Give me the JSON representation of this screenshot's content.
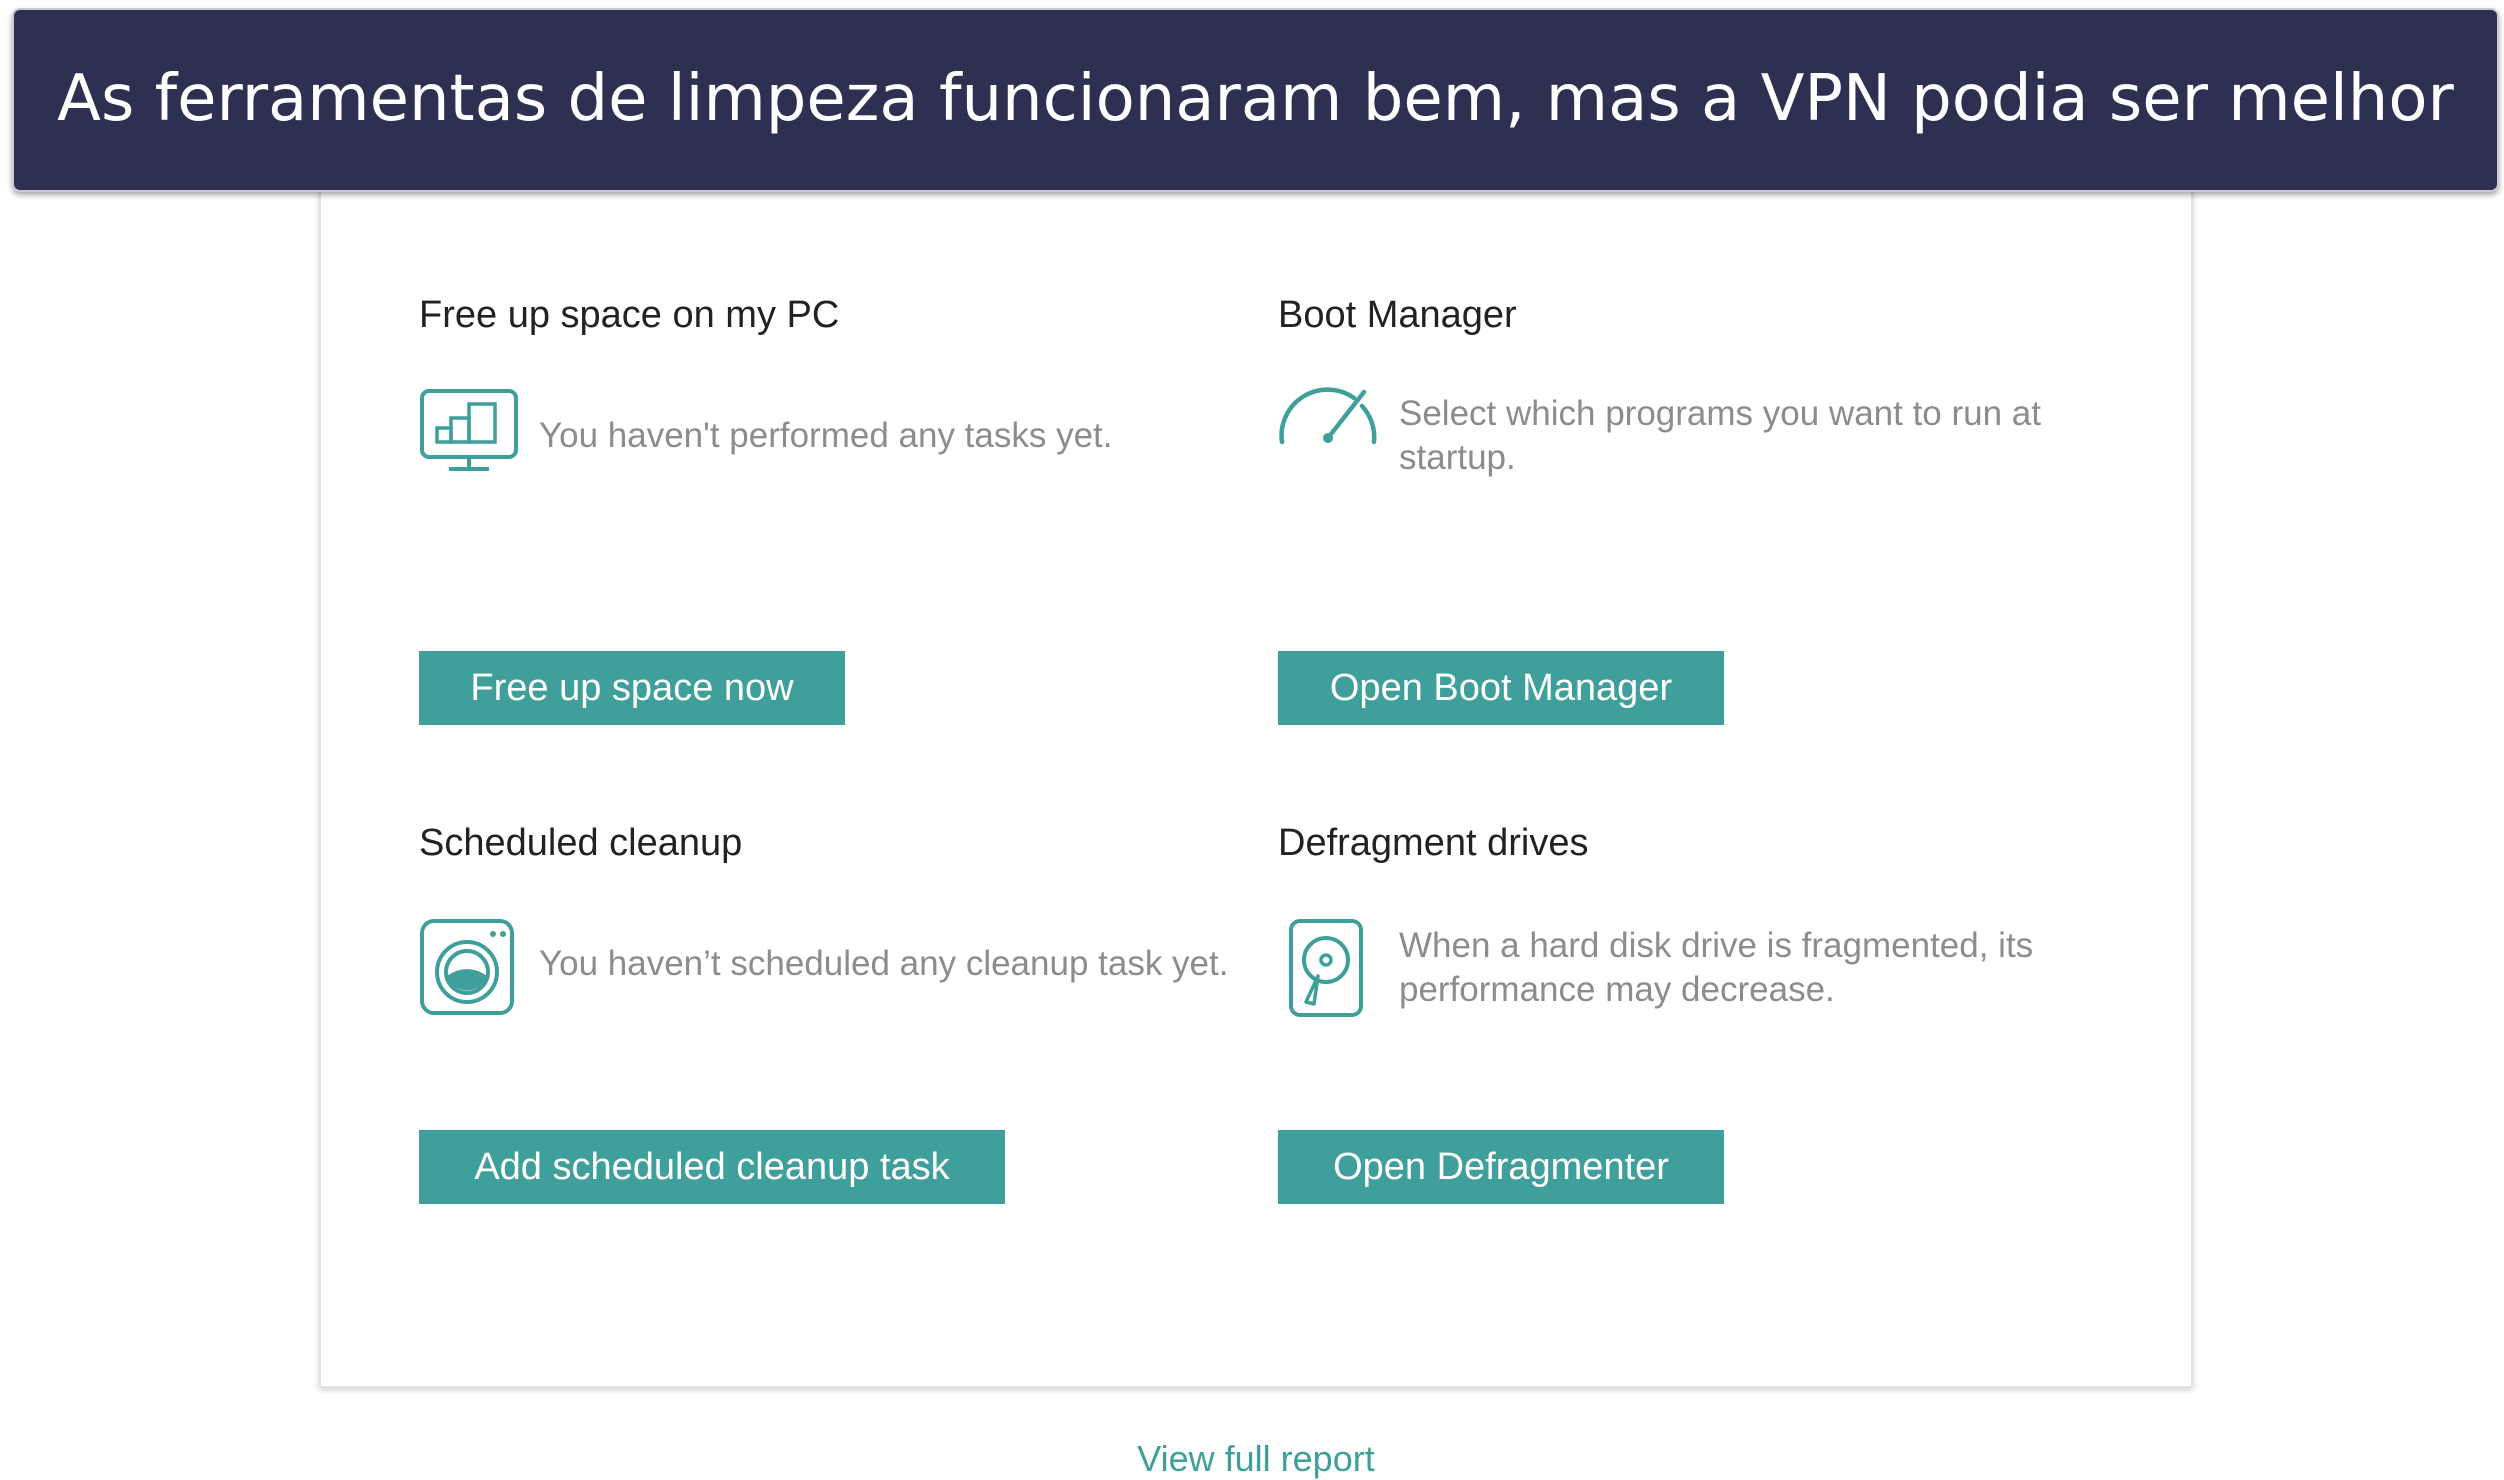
{
  "banner": {
    "caption": "As ferramentas de limpeza funcionaram bem, mas a VPN podia ser melhor"
  },
  "free_space": {
    "title": "Free up space on my PC",
    "description": "You haven't performed any tasks yet.",
    "button": "Free up space now",
    "icon": "monitor-icon"
  },
  "boot_manager": {
    "title": "Boot Manager",
    "description": "Select which programs you want to run at startup.",
    "button": "Open Boot Manager",
    "icon": "speedometer-icon"
  },
  "scheduled_cleanup": {
    "title": "Scheduled cleanup",
    "description": "You haven’t scheduled any cleanup task yet.",
    "button": "Add scheduled cleanup task",
    "icon": "washing-machine-icon"
  },
  "defragment": {
    "title": "Defragment drives",
    "description": "When a hard disk drive is fragmented, its performance may decrease.",
    "button": "Open Defragmenter",
    "icon": "hard-disk-icon"
  },
  "footer": {
    "link": "View full report"
  },
  "colors": {
    "accent": "#3f9f9a",
    "banner": "#2e3052",
    "muted_text": "#8c8c8c"
  }
}
